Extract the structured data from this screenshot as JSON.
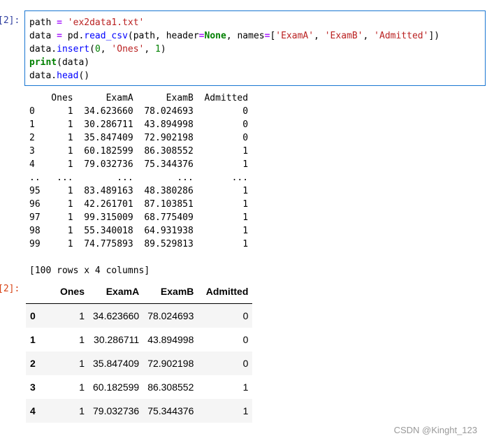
{
  "cell": {
    "in_prompt": "[2]:",
    "out_prompt": "[2]:",
    "code": {
      "line1": {
        "var": "path",
        "eq": " = ",
        "str": "'ex2data1.txt'"
      },
      "line2": {
        "var": "data",
        "eq": " = ",
        "obj": "pd.",
        "fn": "read_csv",
        "open": "(path, ",
        "kw1": "header",
        "kw_eq1": "=",
        "none": "None",
        "comma": ", ",
        "kw2": "names",
        "kw_eq2": "=",
        "list_open": "[",
        "s1": "'ExamA'",
        "c1": ", ",
        "s2": "'ExamB'",
        "c2": ", ",
        "s3": "'Admitted'",
        "close": "])"
      },
      "line3": {
        "obj": "data.",
        "fn": "insert",
        "open": "(",
        "n0": "0",
        "c1": ", ",
        "s": "'Ones'",
        "c2": ", ",
        "n1": "1",
        "close": ")"
      },
      "line4": {
        "fn": "print",
        "rest": "(data)"
      },
      "line5": {
        "obj": "data.",
        "fn": "head",
        "rest": "()"
      }
    },
    "printed_output": "    Ones      ExamA      ExamB  Admitted\n0      1  34.623660  78.024693         0\n1      1  30.286711  43.894998         0\n2      1  35.847409  72.902198         0\n3      1  60.182599  86.308552         1\n4      1  79.032736  75.344376         1\n..   ...        ...        ...       ...\n95     1  83.489163  48.380286         1\n96     1  42.261701  87.103851         1\n97     1  99.315009  68.775409         1\n98     1  55.340018  64.931938         1\n99     1  74.775893  89.529813         1\n\n[100 rows x 4 columns]"
  },
  "dataframe": {
    "columns": [
      "",
      "Ones",
      "ExamA",
      "ExamB",
      "Admitted"
    ],
    "rows": [
      [
        "0",
        "1",
        "34.623660",
        "78.024693",
        "0"
      ],
      [
        "1",
        "1",
        "30.286711",
        "43.894998",
        "0"
      ],
      [
        "2",
        "1",
        "35.847409",
        "72.902198",
        "0"
      ],
      [
        "3",
        "1",
        "60.182599",
        "86.308552",
        "1"
      ],
      [
        "4",
        "1",
        "79.032736",
        "75.344376",
        "1"
      ]
    ]
  },
  "watermark": "CSDN @Kinght_123"
}
